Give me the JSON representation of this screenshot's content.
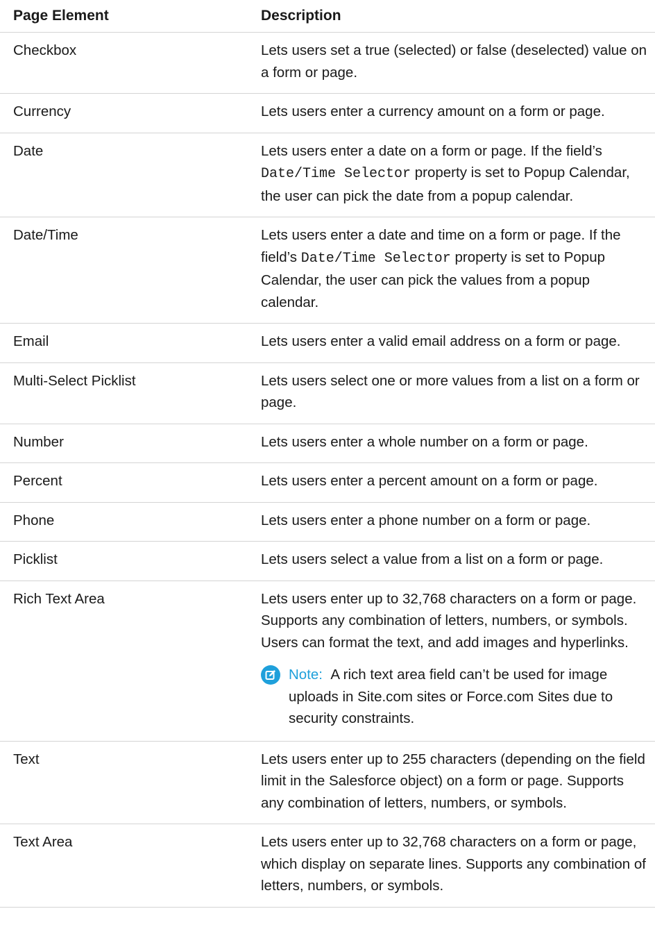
{
  "table": {
    "headers": {
      "element": "Page Element",
      "description": "Description"
    },
    "rows": [
      {
        "element": "Checkbox",
        "description": "Lets users set a true (selected) or false (deselected) value on a form or page."
      },
      {
        "element": "Currency",
        "description": "Lets users enter a currency amount on a form or page."
      },
      {
        "element": "Date",
        "desc_pre": "Lets users enter a date on a form or page. If the field’s ",
        "desc_code": "Date/Time Selector",
        "desc_post": " property is set to Popup Calendar, the user can pick the date from a popup calendar."
      },
      {
        "element": "Date/Time",
        "desc_pre": "Lets users enter a date and time on a form or page. If the field’s ",
        "desc_code": "Date/Time Selector",
        "desc_post": " property is set to Popup Calendar, the user can pick the values from a popup calendar."
      },
      {
        "element": "Email",
        "description": "Lets users enter a valid email address on a form or page."
      },
      {
        "element": "Multi-Select Picklist",
        "description": "Lets users select one or more values from a list on a form or page."
      },
      {
        "element": "Number",
        "description": "Lets users enter a whole number on a form or page."
      },
      {
        "element": "Percent",
        "description": "Lets users enter a percent amount on a form or page."
      },
      {
        "element": "Phone",
        "description": "Lets users enter a phone number on a form or page."
      },
      {
        "element": "Picklist",
        "description": "Lets users select a value from a list on a form or page."
      },
      {
        "element": "Rich Text Area",
        "description": "Lets users enter up to 32,768 characters on a form or page. Supports any combination of letters, numbers, or symbols. Users can format the text, and add images and hyperlinks.",
        "note_label": "Note:",
        "note_text": "A rich text area field can’t be used for image uploads in Site.com sites or Force.com Sites due to security constraints.",
        "note_icon": "edit-note-icon"
      },
      {
        "element": "Text",
        "description": "Lets users enter up to 255 characters (depending on the field limit in the Salesforce object) on a form or page. Supports any combination of letters, numbers, or symbols."
      },
      {
        "element": "Text Area",
        "description": "Lets users enter up to 32,768 characters on a form or page, which display on separate lines. Supports any combination of letters, numbers, or symbols."
      }
    ]
  },
  "colors": {
    "note_accent": "#1fa0db",
    "divider": "#d4d4d4"
  }
}
